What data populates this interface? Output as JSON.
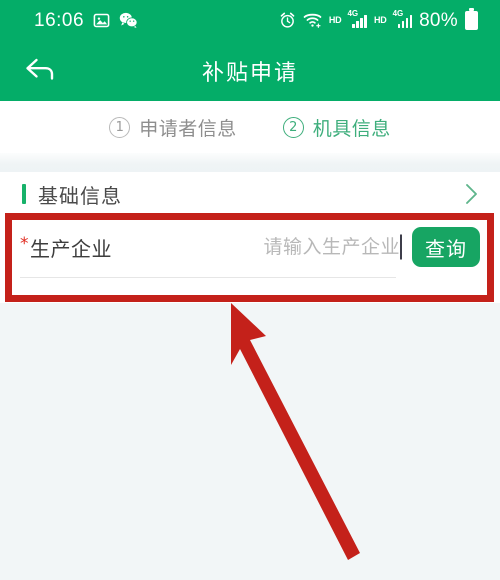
{
  "status_bar": {
    "time": "16:06",
    "battery_text": "80%",
    "icons": [
      "photos-icon",
      "wechat-icon",
      "alarm-clock-icon",
      "wifi-icon",
      "hd-badge-icon",
      "signal-4g-icon",
      "hd-badge-icon-2",
      "signal-4g-icon-2",
      "battery-icon"
    ],
    "hd_label": "HD",
    "network_label": "4G"
  },
  "header": {
    "title": "补贴申请",
    "back_icon": "back-arrow-icon",
    "background_color": "#04ad68"
  },
  "steps": [
    {
      "number": "1",
      "label": "申请者信息",
      "active": false
    },
    {
      "number": "2",
      "label": "机具信息",
      "active": true
    }
  ],
  "section": {
    "title": "基础信息",
    "chevron_icon": "chevron-right-icon",
    "accent_color": "#17b26a"
  },
  "form": {
    "field_label": "生产企业",
    "required_mark": "*",
    "input_value": "",
    "input_placeholder": "请输入生产企业",
    "query_button_label": "查询",
    "query_button_color": "#17a563"
  },
  "annotation": {
    "highlight_color": "#c4211a",
    "box_label": "highlight-box",
    "arrow_label": "pointer-arrow"
  }
}
